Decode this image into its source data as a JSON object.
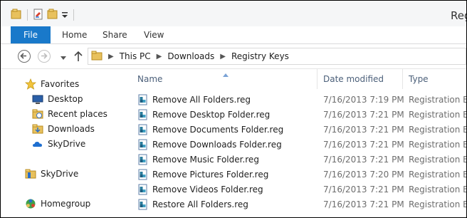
{
  "window": {
    "title": "Registry Keys"
  },
  "quick_access": {
    "icons": [
      "folder-icon",
      "properties-icon",
      "new-folder-icon",
      "customize-chevron-icon"
    ]
  },
  "ribbon": {
    "tabs": [
      {
        "label": "File",
        "active": true
      },
      {
        "label": "Home"
      },
      {
        "label": "Share"
      },
      {
        "label": "View"
      }
    ]
  },
  "address_bar": {
    "breadcrumbs": [
      "This PC",
      "Downloads",
      "Registry Keys"
    ]
  },
  "navigation_pane": {
    "favorites": {
      "label": "Favorites",
      "items": [
        {
          "label": "Desktop",
          "icon": "desktop-icon"
        },
        {
          "label": "Recent places",
          "icon": "recent-places-icon"
        },
        {
          "label": "Downloads",
          "icon": "downloads-folder-icon"
        },
        {
          "label": "SkyDrive",
          "icon": "skydrive-icon"
        }
      ]
    },
    "skydrive": {
      "label": "SkyDrive"
    },
    "homegroup": {
      "label": "Homegroup"
    }
  },
  "file_list": {
    "columns": {
      "name": "Name",
      "date": "Date modified",
      "type": "Type"
    },
    "sorted_by": "Name",
    "files": [
      {
        "name": "Remove All Folders.reg",
        "date": "7/16/2013 7:19 PM",
        "type": "Registration Ent"
      },
      {
        "name": "Remove Desktop Folder.reg",
        "date": "7/16/2013 7:21 PM",
        "type": "Registration Ent"
      },
      {
        "name": "Remove Documents Folder.reg",
        "date": "7/16/2013 7:21 PM",
        "type": "Registration Ent"
      },
      {
        "name": "Remove Downloads Folder.reg",
        "date": "7/16/2013 7:21 PM",
        "type": "Registration Ent"
      },
      {
        "name": "Remove Music Folder.reg",
        "date": "7/16/2013 7:21 PM",
        "type": "Registration Ent"
      },
      {
        "name": "Remove Pictures Folder.reg",
        "date": "7/16/2013 7:20 PM",
        "type": "Registration Ent"
      },
      {
        "name": "Remove Videos Folder.reg",
        "date": "7/16/2013 7:21 PM",
        "type": "Registration Ent"
      },
      {
        "name": "Restore All Folders.reg",
        "date": "7/16/2013 7:21 PM",
        "type": "Registration Ent"
      }
    ]
  },
  "colors": {
    "accent": "#1979ca",
    "header_text": "#4c607a",
    "secondary_text": "#6d6d6d"
  }
}
